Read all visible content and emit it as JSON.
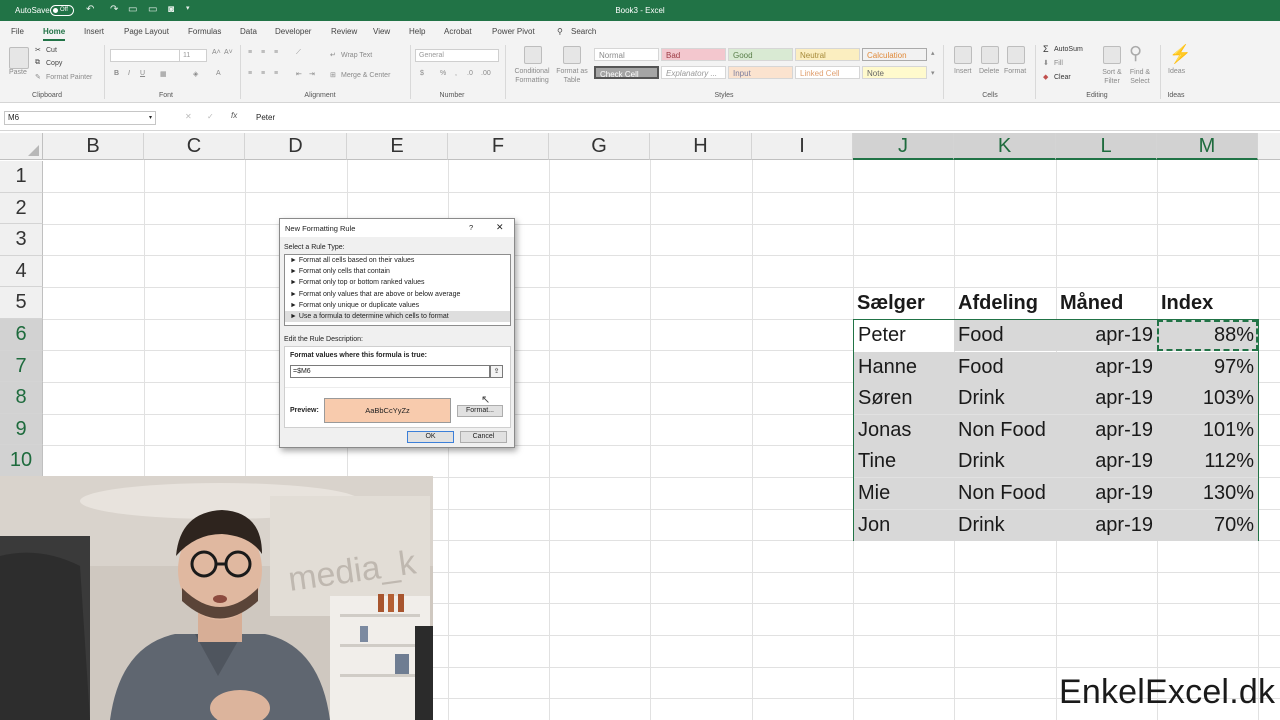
{
  "titlebar": {
    "autosave_label": "AutoSave",
    "autosave_state": "Off",
    "title": "Book3  -  Excel"
  },
  "menu": {
    "tabs": [
      "File",
      "Home",
      "Insert",
      "Page Layout",
      "Formulas",
      "Data",
      "Developer",
      "Review",
      "View",
      "Help",
      "Acrobat",
      "Power Pivot"
    ],
    "search": "Search"
  },
  "ribbon": {
    "clipboard": {
      "paste": "Paste",
      "cut": "Cut",
      "copy": "Copy",
      "format_painter": "Format Painter",
      "label": "Clipboard"
    },
    "font": {
      "label": "Font",
      "size": "11"
    },
    "alignment": {
      "wrap": "Wrap Text",
      "merge": "Merge & Center",
      "label": "Alignment"
    },
    "number": {
      "format": "General",
      "label": "Number"
    },
    "styles": {
      "conditional": "Conditional Formatting",
      "format_table": "Format as Table",
      "cells": [
        "Normal",
        "Bad",
        "Good",
        "Neutral",
        "Calculation",
        "Check Cell",
        "Explanatory ...",
        "Input",
        "Linked Cell",
        "Note"
      ],
      "label": "Styles"
    },
    "cells": {
      "insert": "Insert",
      "delete": "Delete",
      "format": "Format",
      "label": "Cells"
    },
    "editing": {
      "autosum": "AutoSum",
      "fill": "Fill",
      "clear": "Clear",
      "sort": "Sort & Filter",
      "find": "Find & Select",
      "label": "Editing"
    },
    "ideas": {
      "ideas": "Ideas",
      "label": "Ideas"
    }
  },
  "formula_bar": {
    "name_box": "M6",
    "content": "Peter"
  },
  "columns": [
    "B",
    "C",
    "D",
    "E",
    "F",
    "G",
    "H",
    "I",
    "J",
    "K",
    "L",
    "M"
  ],
  "rows": [
    "1",
    "2",
    "3",
    "4",
    "5",
    "6",
    "7",
    "8",
    "9",
    "10"
  ],
  "table": {
    "headers": [
      "Sælger",
      "Afdeling",
      "Måned",
      "Index"
    ],
    "rows": [
      [
        "Peter",
        "Food",
        "apr-19",
        "88%"
      ],
      [
        "Hanne",
        "Food",
        "apr-19",
        "97%"
      ],
      [
        "Søren",
        "Drink",
        "apr-19",
        "103%"
      ],
      [
        "Jonas",
        "Non Food",
        "apr-19",
        "101%"
      ],
      [
        "Tine",
        "Drink",
        "apr-19",
        "112%"
      ],
      [
        "Mie",
        "Non Food",
        "apr-19",
        "130%"
      ],
      [
        "Jon",
        "Drink",
        "apr-19",
        "70%"
      ]
    ]
  },
  "dialog": {
    "title": "New Formatting Rule",
    "help": "?",
    "select_label": "Select a Rule Type:",
    "rule_types": [
      "► Format all cells based on their values",
      "► Format only cells that contain",
      "► Format only top or bottom ranked values",
      "► Format only values that are above or below average",
      "► Format only unique or duplicate values",
      "► Use a formula to determine which cells to format"
    ],
    "edit_label": "Edit the Rule Description:",
    "formula_label": "Format values where this formula is true:",
    "formula_value": "=$M6",
    "preview_label": "Preview:",
    "preview_text": "AaBbCcYyZz",
    "preview_color": "#f8cbad",
    "format_button": "Format...",
    "ok": "OK",
    "cancel": "Cancel"
  },
  "watermark": "EnkelExcel.dk",
  "colors": {
    "excel_green": "#217346",
    "selection_gray": "#d8d8d8"
  }
}
